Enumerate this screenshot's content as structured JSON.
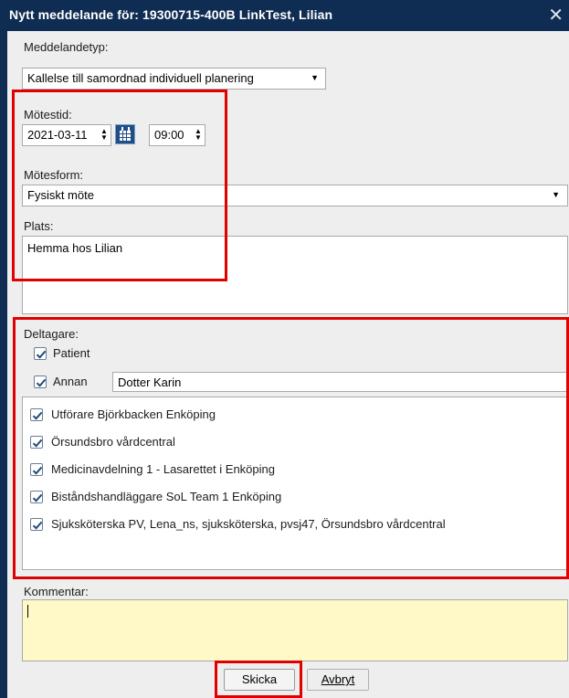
{
  "window": {
    "title": "Nytt meddelande för: 19300715-400B LinkTest, Lilian",
    "close_glyph": "✕"
  },
  "message_type": {
    "label": "Meddelandetyp:",
    "value": "Kallelse till samordnad individuell planering"
  },
  "meeting_time": {
    "label": "Mötestid:",
    "date": "2021-03-11",
    "time": "09:00"
  },
  "meeting_form": {
    "label": "Mötesform:",
    "value": "Fysiskt möte"
  },
  "place": {
    "label": "Plats:",
    "value": "Hemma hos Lilian"
  },
  "participants": {
    "label": "Deltagare:",
    "patient": {
      "label": "Patient",
      "checked": true
    },
    "other": {
      "label": "Annan",
      "checked": true,
      "value": "Dotter Karin"
    },
    "list": [
      "Utförare Björkbacken Enköping",
      "Örsundsbro vårdcentral",
      "Medicinavdelning 1 - Lasarettet i Enköping",
      "Biståndshandläggare SoL Team 1 Enköping",
      "Sjuksköterska PV, Lena_ns, sjuksköterska, pvsj47, Örsundsbro vårdcentral"
    ]
  },
  "comment": {
    "label": "Kommentar:",
    "value": ""
  },
  "buttons": {
    "send": "Skicka",
    "cancel": "Avbryt"
  },
  "colors": {
    "titlebar": "#0f2d52",
    "highlight": "#e00000",
    "comment_bg": "#fff8c7"
  }
}
